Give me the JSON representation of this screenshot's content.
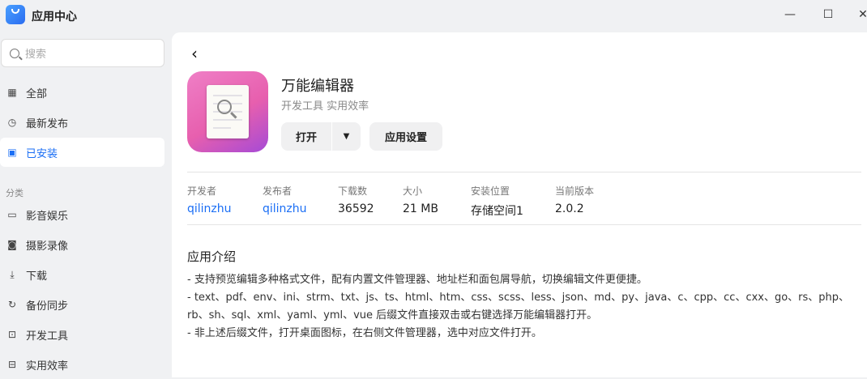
{
  "window": {
    "title": "应用中心",
    "logo_text": "STORE",
    "minimize": "—",
    "maximize": "☐",
    "close": "✕"
  },
  "sidebar": {
    "search_placeholder": "搜索",
    "items": [
      {
        "label": "全部",
        "icon": "grid-icon"
      },
      {
        "label": "最新发布",
        "icon": "clock-icon"
      },
      {
        "label": "已安装",
        "icon": "installed-icon"
      }
    ],
    "category_label": "分类",
    "categories": [
      {
        "label": "影音娱乐",
        "icon": "video-icon"
      },
      {
        "label": "摄影录像",
        "icon": "camera-icon"
      },
      {
        "label": "下载",
        "icon": "download-icon"
      },
      {
        "label": "备份同步",
        "icon": "sync-icon"
      },
      {
        "label": "开发工具",
        "icon": "code-icon"
      },
      {
        "label": "实用效率",
        "icon": "briefcase-icon"
      }
    ]
  },
  "app": {
    "name": "万能编辑器",
    "tags": "开发工具 实用效率",
    "open_label": "打开",
    "settings_label": "应用设置",
    "meta": [
      {
        "key": "开发者",
        "value": "qilinzhu",
        "link": true
      },
      {
        "key": "发布者",
        "value": "qilinzhu",
        "link": true
      },
      {
        "key": "下载数",
        "value": "36592"
      },
      {
        "key": "大小",
        "value": "21 MB"
      },
      {
        "key": "安装位置",
        "value": "存储空间1"
      },
      {
        "key": "当前版本",
        "value": "2.0.2"
      }
    ],
    "intro_title": "应用介绍",
    "intro_lines": [
      "- 支持预览编辑多种格式文件，配有内置文件管理器、地址栏和面包屑导航，切换编辑文件更便捷。",
      "- text、pdf、env、ini、strm、txt、js、ts、html、htm、css、scss、less、json、md、py、java、c、cpp、cc、cxx、go、rs、php、rb、sh、sql、xml、yaml、yml、vue 后缀文件直接双击或右键选择万能编辑器打开。",
      "- 非上述后缀文件，打开桌面图标，在右侧文件管理器，选中对应文件打开。"
    ]
  },
  "colors": {
    "accent": "#1a6ef5",
    "background": "#f0f1f3"
  }
}
